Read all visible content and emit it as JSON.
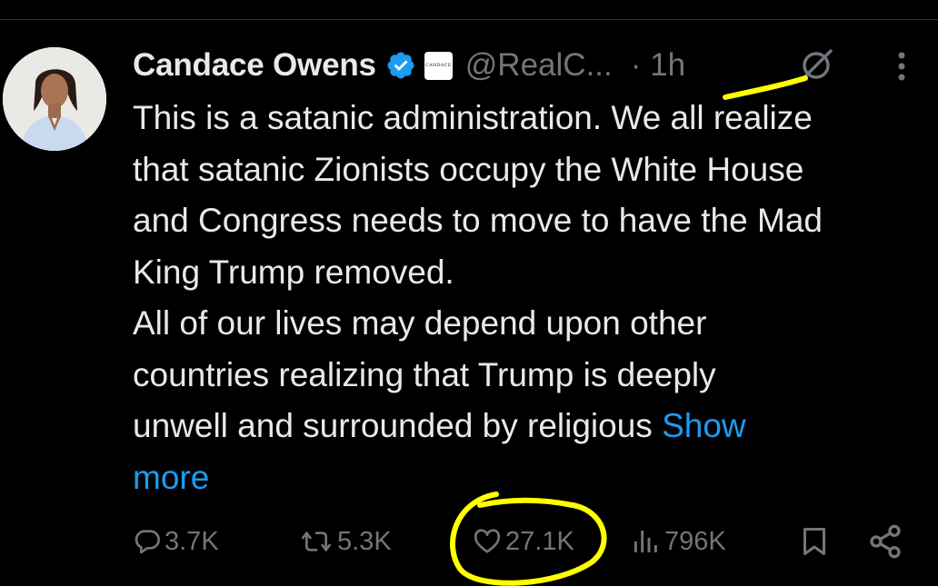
{
  "tweet": {
    "author_name": "Candace Owens",
    "affiliation_badge": "CANDACE",
    "handle": "@RealC...",
    "time": "· 1h",
    "text_lines": [
      "This is a satanic administration. We all realize",
      "that satanic Zionists occupy the White House",
      "and Congress needs to move to have the Mad",
      "King Trump removed.",
      "All of our lives may depend upon other",
      "countries realizing that Trump is deeply",
      "unwell and surrounded by religious "
    ],
    "show_more_first": "Show",
    "show_more_second": "more"
  },
  "actions": {
    "replies": "3.7K",
    "reposts": "5.3K",
    "likes": "27.1K",
    "views": "796K"
  },
  "icons": {
    "verified": "verified-badge-icon",
    "grok": "grok-icon",
    "more": "more-options-icon",
    "reply": "reply-icon",
    "repost": "repost-icon",
    "like": "heart-icon",
    "views": "views-chart-icon",
    "bookmark": "bookmark-icon",
    "share": "share-icon"
  },
  "colors": {
    "background": "#000000",
    "text": "#e7e9ea",
    "secondary": "#71767b",
    "link": "#1d9bf0",
    "verified": "#1d9bf0",
    "annotation_highlight": "#ffff00"
  }
}
